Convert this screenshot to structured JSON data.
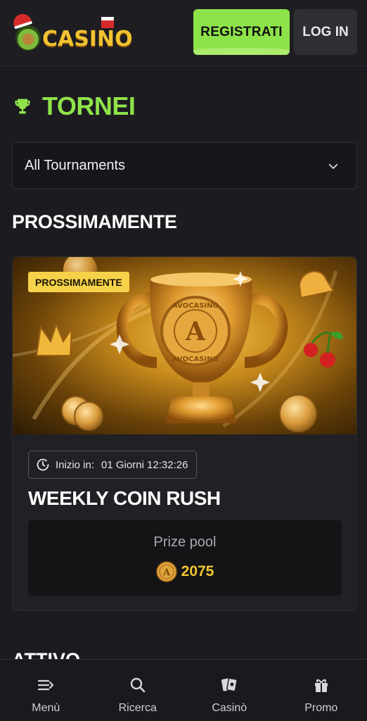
{
  "header": {
    "logo_text": "CASINO",
    "register_label": "REGISTRATI",
    "login_label": "LOG IN"
  },
  "page": {
    "title": "TORNEI",
    "filter_value": "All Tournaments",
    "section_upcoming": "PROSSIMAMENTE",
    "section_active": "ATTIVO"
  },
  "tournament": {
    "badge": "PROSSIMAMENTE",
    "start_label": "Inizio in:",
    "countdown": "01 Giorni 12:32:26",
    "name": "WEEKLY COIN RUSH",
    "prize_label": "Prize pool",
    "prize_value": "2075",
    "banner_text_top": "AVOCASINO",
    "banner_text_bottom": "AVOCASINO",
    "banner_letter": "A"
  },
  "nav": {
    "items": [
      {
        "label": "Menù",
        "icon": "menu-icon"
      },
      {
        "label": "Ricerca",
        "icon": "search-icon"
      },
      {
        "label": "Casinò",
        "icon": "cards-icon"
      },
      {
        "label": "Promo",
        "icon": "gift-icon"
      }
    ]
  },
  "colors": {
    "accent": "#8fe34a",
    "gold": "#f3c62e",
    "background": "#1c1c20"
  }
}
